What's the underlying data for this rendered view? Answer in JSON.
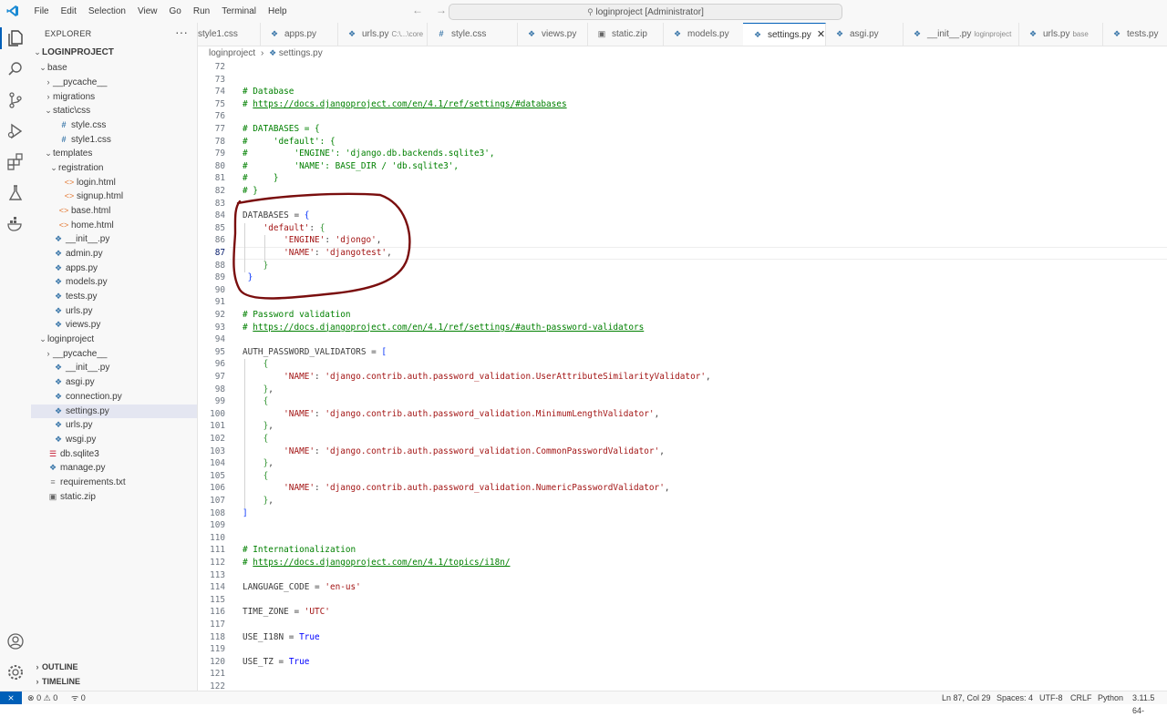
{
  "title_bar": {
    "menus": [
      "File",
      "Edit",
      "Selection",
      "View",
      "Go",
      "Run",
      "Terminal",
      "Help"
    ],
    "command_center": "loginproject [Administrator]"
  },
  "explorer": {
    "header": "EXPLORER",
    "root": "LOGINPROJECT",
    "tree": [
      {
        "label": "base",
        "depth": 1,
        "kind": "folder",
        "open": true
      },
      {
        "label": "__pycache__",
        "depth": 2,
        "kind": "folder",
        "open": false
      },
      {
        "label": "migrations",
        "depth": 2,
        "kind": "folder",
        "open": false
      },
      {
        "label": "static\\css",
        "depth": 2,
        "kind": "folder",
        "open": true
      },
      {
        "label": "style.css",
        "depth": 3,
        "kind": "css"
      },
      {
        "label": "style1.css",
        "depth": 3,
        "kind": "css"
      },
      {
        "label": "templates",
        "depth": 2,
        "kind": "folder",
        "open": true
      },
      {
        "label": "registration",
        "depth": 3,
        "kind": "folder",
        "open": true
      },
      {
        "label": "login.html",
        "depth": 4,
        "kind": "html"
      },
      {
        "label": "signup.html",
        "depth": 4,
        "kind": "html"
      },
      {
        "label": "base.html",
        "depth": 3,
        "kind": "html"
      },
      {
        "label": "home.html",
        "depth": 3,
        "kind": "html"
      },
      {
        "label": "__init__.py",
        "depth": 2,
        "kind": "py"
      },
      {
        "label": "admin.py",
        "depth": 2,
        "kind": "py"
      },
      {
        "label": "apps.py",
        "depth": 2,
        "kind": "py"
      },
      {
        "label": "models.py",
        "depth": 2,
        "kind": "py"
      },
      {
        "label": "tests.py",
        "depth": 2,
        "kind": "py"
      },
      {
        "label": "urls.py",
        "depth": 2,
        "kind": "py"
      },
      {
        "label": "views.py",
        "depth": 2,
        "kind": "py"
      },
      {
        "label": "loginproject",
        "depth": 1,
        "kind": "folder",
        "open": true
      },
      {
        "label": "__pycache__",
        "depth": 2,
        "kind": "folder",
        "open": false
      },
      {
        "label": "__init__.py",
        "depth": 2,
        "kind": "py"
      },
      {
        "label": "asgi.py",
        "depth": 2,
        "kind": "py"
      },
      {
        "label": "connection.py",
        "depth": 2,
        "kind": "py"
      },
      {
        "label": "settings.py",
        "depth": 2,
        "kind": "py",
        "selected": true
      },
      {
        "label": "urls.py",
        "depth": 2,
        "kind": "py"
      },
      {
        "label": "wsgi.py",
        "depth": 2,
        "kind": "py"
      },
      {
        "label": "db.sqlite3",
        "depth": 1,
        "kind": "db"
      },
      {
        "label": "manage.py",
        "depth": 1,
        "kind": "py"
      },
      {
        "label": "requirements.txt",
        "depth": 1,
        "kind": "txt"
      },
      {
        "label": "static.zip",
        "depth": 1,
        "kind": "zip"
      }
    ],
    "outline_label": "OUTLINE",
    "timeline_label": "TIMELINE"
  },
  "tabs": [
    {
      "label": "style1.css",
      "kind": "css",
      "desc": ""
    },
    {
      "label": "apps.py",
      "kind": "py",
      "desc": ""
    },
    {
      "label": "urls.py",
      "kind": "py",
      "desc": "C:\\...\\core"
    },
    {
      "label": "style.css",
      "kind": "css",
      "desc": ""
    },
    {
      "label": "views.py",
      "kind": "py",
      "desc": ""
    },
    {
      "label": "static.zip",
      "kind": "zip",
      "desc": ""
    },
    {
      "label": "models.py",
      "kind": "py",
      "desc": ""
    },
    {
      "label": "settings.py",
      "kind": "py",
      "desc": "",
      "active": true
    },
    {
      "label": "asgi.py",
      "kind": "py",
      "desc": ""
    },
    {
      "label": "__init__.py",
      "kind": "py",
      "desc": "loginproject"
    },
    {
      "label": "urls.py",
      "kind": "py",
      "desc": "base"
    },
    {
      "label": "tests.py",
      "kind": "py",
      "desc": ""
    }
  ],
  "breadcrumb": {
    "folder": "loginproject",
    "file": "settings.py"
  },
  "editor": {
    "current_line": 87,
    "lines": [
      {
        "n": 72,
        "t": []
      },
      {
        "n": 73,
        "t": []
      },
      {
        "n": 74,
        "t": [
          [
            "cmt",
            "# Database"
          ]
        ]
      },
      {
        "n": 75,
        "t": [
          [
            "cmt",
            "# "
          ],
          [
            "url",
            "https://docs.djangoproject.com/en/4.1/ref/settings/#databases"
          ]
        ]
      },
      {
        "n": 76,
        "t": []
      },
      {
        "n": 77,
        "t": [
          [
            "cmt",
            "# DATABASES = {"
          ]
        ]
      },
      {
        "n": 78,
        "t": [
          [
            "cmt",
            "#     'default': {"
          ]
        ]
      },
      {
        "n": 79,
        "t": [
          [
            "cmt",
            "#         'ENGINE': 'django.db.backends.sqlite3',"
          ]
        ]
      },
      {
        "n": 80,
        "t": [
          [
            "cmt",
            "#         'NAME': BASE_DIR / 'db.sqlite3',"
          ]
        ]
      },
      {
        "n": 81,
        "t": [
          [
            "cmt",
            "#     }"
          ]
        ]
      },
      {
        "n": 82,
        "t": [
          [
            "cmt",
            "# }"
          ]
        ]
      },
      {
        "n": 83,
        "t": []
      },
      {
        "n": 84,
        "t": [
          [
            "p",
            "DATABASES = "
          ],
          [
            "br1",
            "{"
          ]
        ]
      },
      {
        "n": 85,
        "t": [
          [
            "p",
            "    "
          ],
          [
            "str",
            "'default'"
          ],
          [
            "p",
            ": "
          ],
          [
            "br2",
            "{"
          ]
        ]
      },
      {
        "n": 86,
        "t": [
          [
            "p",
            "        "
          ],
          [
            "str",
            "'ENGINE'"
          ],
          [
            "p",
            ": "
          ],
          [
            "str",
            "'djongo'"
          ],
          [
            "p",
            ","
          ]
        ]
      },
      {
        "n": 87,
        "t": [
          [
            "p",
            "        "
          ],
          [
            "str",
            "'NAME'"
          ],
          [
            "p",
            ": "
          ],
          [
            "str",
            "'djangotest'"
          ],
          [
            "p",
            ","
          ]
        ]
      },
      {
        "n": 88,
        "t": [
          [
            "p",
            "    "
          ],
          [
            "br2",
            "}"
          ]
        ]
      },
      {
        "n": 89,
        "t": [
          [
            "p",
            " "
          ],
          [
            "br1",
            "}"
          ]
        ]
      },
      {
        "n": 90,
        "t": []
      },
      {
        "n": 91,
        "t": []
      },
      {
        "n": 92,
        "t": [
          [
            "cmt",
            "# Password validation"
          ]
        ]
      },
      {
        "n": 93,
        "t": [
          [
            "cmt",
            "# "
          ],
          [
            "url",
            "https://docs.djangoproject.com/en/4.1/ref/settings/#auth-password-validators"
          ]
        ]
      },
      {
        "n": 94,
        "t": []
      },
      {
        "n": 95,
        "t": [
          [
            "p",
            "AUTH_PASSWORD_VALIDATORS = "
          ],
          [
            "br1",
            "["
          ]
        ]
      },
      {
        "n": 96,
        "t": [
          [
            "p",
            "    "
          ],
          [
            "br2",
            "{"
          ]
        ]
      },
      {
        "n": 97,
        "t": [
          [
            "p",
            "        "
          ],
          [
            "str",
            "'NAME'"
          ],
          [
            "p",
            ": "
          ],
          [
            "str",
            "'django.contrib.auth.password_validation.UserAttributeSimilarityValidator'"
          ],
          [
            "p",
            ","
          ]
        ]
      },
      {
        "n": 98,
        "t": [
          [
            "p",
            "    "
          ],
          [
            "br2",
            "}"
          ],
          [
            "p",
            ","
          ]
        ]
      },
      {
        "n": 99,
        "t": [
          [
            "p",
            "    "
          ],
          [
            "br2",
            "{"
          ]
        ]
      },
      {
        "n": 100,
        "t": [
          [
            "p",
            "        "
          ],
          [
            "str",
            "'NAME'"
          ],
          [
            "p",
            ": "
          ],
          [
            "str",
            "'django.contrib.auth.password_validation.MinimumLengthValidator'"
          ],
          [
            "p",
            ","
          ]
        ]
      },
      {
        "n": 101,
        "t": [
          [
            "p",
            "    "
          ],
          [
            "br2",
            "}"
          ],
          [
            "p",
            ","
          ]
        ]
      },
      {
        "n": 102,
        "t": [
          [
            "p",
            "    "
          ],
          [
            "br2",
            "{"
          ]
        ]
      },
      {
        "n": 103,
        "t": [
          [
            "p",
            "        "
          ],
          [
            "str",
            "'NAME'"
          ],
          [
            "p",
            ": "
          ],
          [
            "str",
            "'django.contrib.auth.password_validation.CommonPasswordValidator'"
          ],
          [
            "p",
            ","
          ]
        ]
      },
      {
        "n": 104,
        "t": [
          [
            "p",
            "    "
          ],
          [
            "br2",
            "}"
          ],
          [
            "p",
            ","
          ]
        ]
      },
      {
        "n": 105,
        "t": [
          [
            "p",
            "    "
          ],
          [
            "br2",
            "{"
          ]
        ]
      },
      {
        "n": 106,
        "t": [
          [
            "p",
            "        "
          ],
          [
            "str",
            "'NAME'"
          ],
          [
            "p",
            ": "
          ],
          [
            "str",
            "'django.contrib.auth.password_validation.NumericPasswordValidator'"
          ],
          [
            "p",
            ","
          ]
        ]
      },
      {
        "n": 107,
        "t": [
          [
            "p",
            "    "
          ],
          [
            "br2",
            "}"
          ],
          [
            "p",
            ","
          ]
        ]
      },
      {
        "n": 108,
        "t": [
          [
            "br1",
            "]"
          ]
        ]
      },
      {
        "n": 109,
        "t": []
      },
      {
        "n": 110,
        "t": []
      },
      {
        "n": 111,
        "t": [
          [
            "cmt",
            "# Internationalization"
          ]
        ]
      },
      {
        "n": 112,
        "t": [
          [
            "cmt",
            "# "
          ],
          [
            "url",
            "https://docs.djangoproject.com/en/4.1/topics/i18n/"
          ]
        ]
      },
      {
        "n": 113,
        "t": []
      },
      {
        "n": 114,
        "t": [
          [
            "p",
            "LANGUAGE_CODE = "
          ],
          [
            "str",
            "'en-us'"
          ]
        ]
      },
      {
        "n": 115,
        "t": []
      },
      {
        "n": 116,
        "t": [
          [
            "p",
            "TIME_ZONE = "
          ],
          [
            "str",
            "'UTC'"
          ]
        ]
      },
      {
        "n": 117,
        "t": []
      },
      {
        "n": 118,
        "t": [
          [
            "p",
            "USE_I18N = "
          ],
          [
            "kw",
            "True"
          ]
        ]
      },
      {
        "n": 119,
        "t": []
      },
      {
        "n": 120,
        "t": [
          [
            "p",
            "USE_TZ = "
          ],
          [
            "kw",
            "True"
          ]
        ]
      },
      {
        "n": 121,
        "t": []
      },
      {
        "n": 122,
        "t": []
      }
    ]
  },
  "status_bar": {
    "errors": "0",
    "warnings": "0",
    "ports": "0",
    "cursor": "Ln 87, Col 29",
    "spaces": "Spaces: 4",
    "encoding": "UTF-8",
    "eol": "CRLF",
    "language": "Python",
    "interpreter": "3.11.5 64-"
  },
  "colors": {
    "accent": "#005fb8",
    "annotation_circle": "#7a0e0e",
    "comment": "#008000",
    "string": "#a31515"
  }
}
